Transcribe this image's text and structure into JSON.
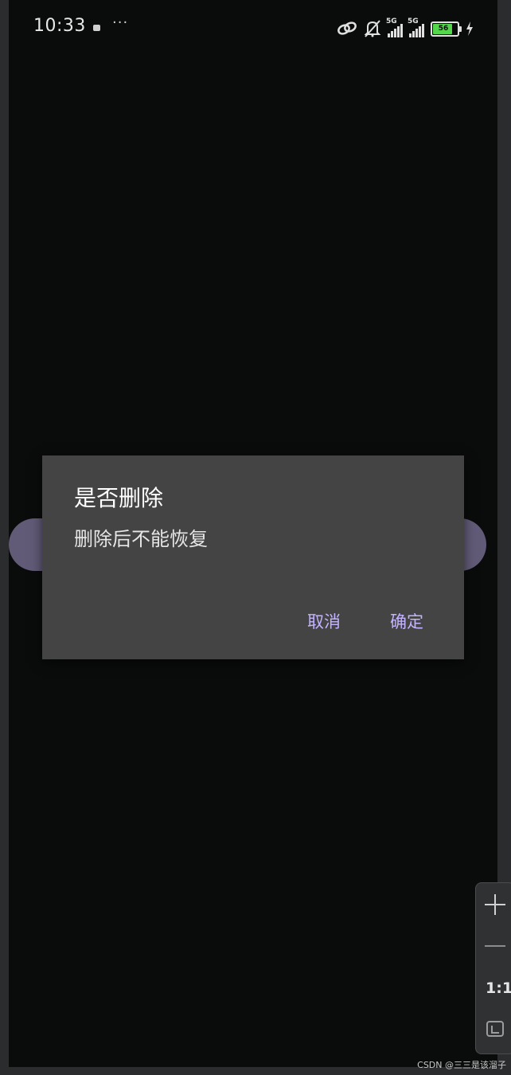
{
  "status_bar": {
    "time": "10:33",
    "more": "···",
    "signal_1_label": "5G",
    "signal_2_label": "5G",
    "battery_level": "56",
    "icons": [
      "link-icon",
      "bell-off-icon",
      "signal-icon",
      "signal-icon",
      "battery-icon",
      "charging-icon"
    ]
  },
  "dialog": {
    "title": "是否删除",
    "message": "删除后不能恢复",
    "cancel_label": "取消",
    "confirm_label": "确定",
    "accent_color": "#c4b3ff"
  },
  "zoom_panel": {
    "ratio_label": "1:1",
    "icons": [
      "zoom-in-icon",
      "zoom-out-icon",
      "fit-screen-icon"
    ]
  },
  "watermark": "CSDN @三三是该溜子",
  "colors": {
    "background": "#0a0b0b",
    "dialog": "#444444",
    "pill": "#625b78"
  }
}
